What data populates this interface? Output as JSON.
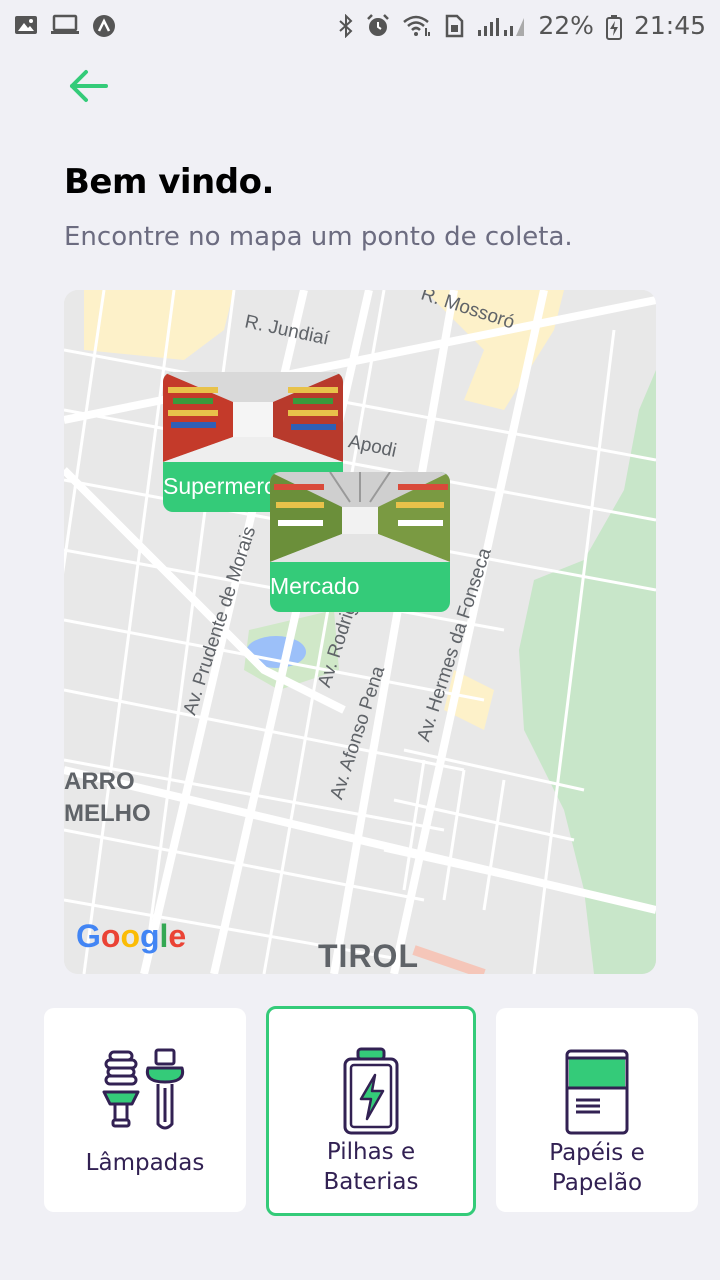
{
  "status_bar": {
    "battery": "22%",
    "time": "21:45",
    "icons": [
      "image-icon",
      "laptop-icon",
      "app-a-icon",
      "bluetooth-icon",
      "alarm-icon",
      "wifi-icon",
      "sim-icon",
      "signal-icon",
      "battery-icon"
    ]
  },
  "header": {
    "back_icon": "arrow-left-icon",
    "title": "Bem vindo.",
    "subtitle": "Encontre no mapa um ponto de coleta."
  },
  "map": {
    "street_labels": [
      "R. Mossoró",
      "R. Jundiaí",
      "Apodi",
      "Av. Prudente de Morais",
      "Av. Rodrigues",
      "Av. Afonso Pena",
      "Av. Hermes da Fonseca"
    ],
    "area_labels": [
      "ARRO",
      "MELHO",
      "TIROL"
    ],
    "attribution": "Google",
    "points": [
      {
        "label": "Supermercado",
        "image": "supermarket-aisle-photo"
      },
      {
        "label": "Mercado",
        "image": "market-aisle-photo"
      }
    ],
    "colors": {
      "park": "#C8E6C9",
      "water": "#8AB4F8",
      "road": "#FFFFFF",
      "land": "#E8E8E8",
      "highlight": "#FDF1C9"
    }
  },
  "categories": [
    {
      "label": "Lâmpadas",
      "icon": "lamps-icon",
      "selected": false
    },
    {
      "label": "Pilhas e Baterias",
      "label_line1": "Pilhas e",
      "label_line2": "Baterias",
      "icon": "battery-bolt-icon",
      "selected": true
    },
    {
      "label": "Papéis e Papelão",
      "label_line1": "Papéis e",
      "label_line2": "Papelão",
      "icon": "paper-icon",
      "selected": false
    }
  ],
  "colors": {
    "accent": "#34CB79",
    "background": "#F0F0F5",
    "title": "#000000",
    "text": "#6C6C80",
    "card_text": "#322153"
  }
}
